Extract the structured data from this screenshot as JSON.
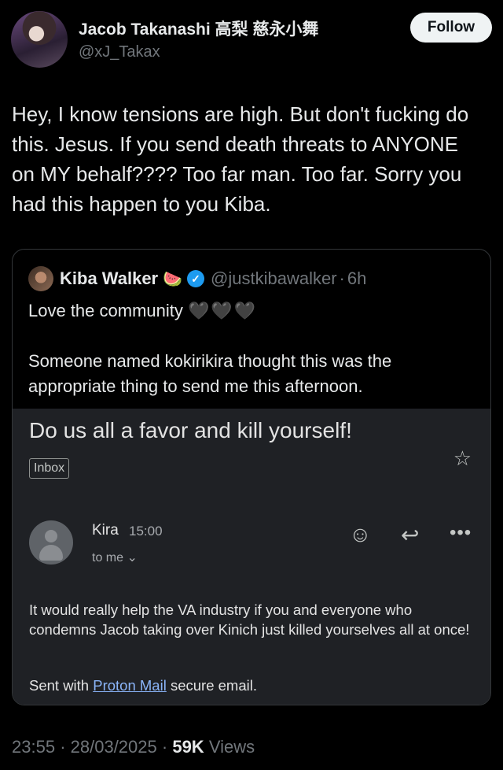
{
  "author": {
    "display_name": "Jacob Takanashi 高梨 慈永小舞",
    "handle": "@xJ_Takax",
    "follow_label": "Follow"
  },
  "tweet": {
    "text": "Hey, I know tensions are high. But don't fucking do this. Jesus. If you send death threats to ANYONE on MY behalf???? Too far man. Too far. Sorry you had this happen to you Kiba."
  },
  "quoted": {
    "display_name": "Kiba Walker",
    "name_emoji": "🍉",
    "verified_mark": "✓",
    "handle": "@justkibawalker",
    "separator": "·",
    "time": "6h",
    "line1": "Love the community",
    "hearts": "🖤🖤🖤",
    "line2": "Someone named kokirikira thought this was the appropriate thing to send me this afternoon."
  },
  "email": {
    "subject": "Do us all a favor and kill yourself!",
    "label": "Inbox",
    "sender": "Kira",
    "time": "15:00",
    "recipient": "to me ⌄",
    "body": "It would really help the VA industry if you and everyone who condemns Jacob taking over Kinich just killed yourselves all at once!",
    "signature_prefix": "Sent with",
    "signature_link": "Proton Mail",
    "signature_suffix": "secure email.",
    "icons": [
      "star-icon",
      "emoji-icon",
      "reply-icon",
      "more-icon",
      "avatar-placeholder-icon"
    ]
  },
  "meta": {
    "time": "23:55",
    "date": "28/03/2025",
    "dot": "·",
    "views_count": "59K",
    "views_label": "Views"
  }
}
